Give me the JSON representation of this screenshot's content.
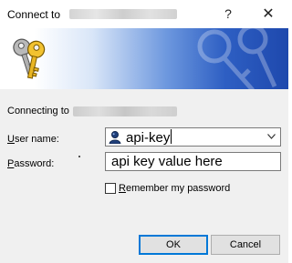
{
  "window": {
    "title_prefix": "Connect to",
    "help_glyph": "?",
    "close_glyph": "✕"
  },
  "form": {
    "connecting_prefix": "Connecting to",
    "username_label_accel": "U",
    "username_label_rest": "ser name:",
    "username_value": "api-key",
    "password_label_accel": "P",
    "password_label_rest": "assword:",
    "password_value": "api key value here",
    "remember_label_accel": "R",
    "remember_label_rest": "emember my password",
    "remember_checked": false
  },
  "buttons": {
    "ok": "OK",
    "cancel": "Cancel"
  },
  "colors": {
    "banner_blue": "#1e48ad",
    "focus_border": "#0078d7"
  }
}
